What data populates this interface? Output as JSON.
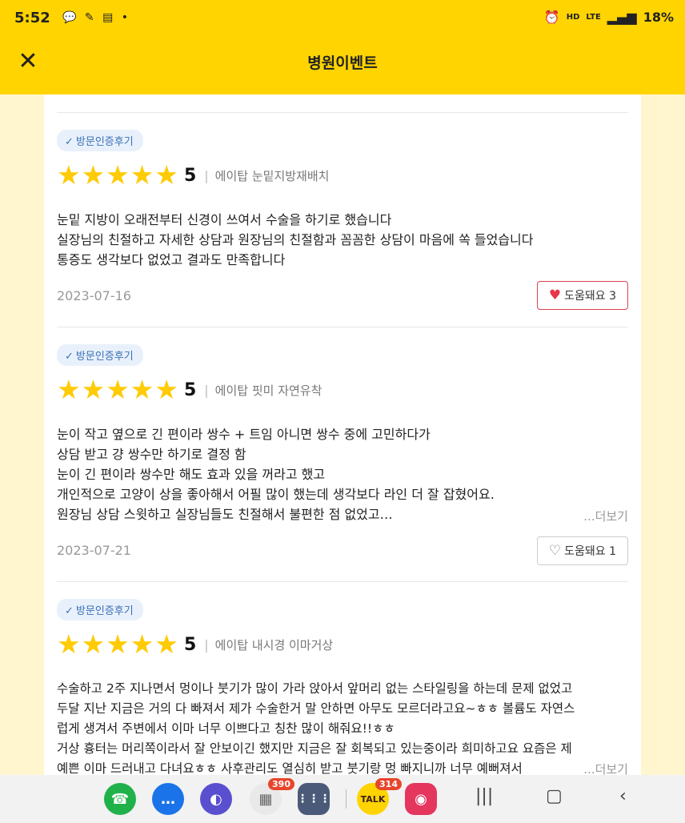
{
  "status_bar": {
    "time": "5:52",
    "left_icons": [
      "talk-icon",
      "pen-icon",
      "grid-icon",
      "dot-icon"
    ],
    "network": "HD",
    "network_sub": "LTE",
    "battery": "18%"
  },
  "header": {
    "title": "병원이벤트"
  },
  "reviews": [
    {
      "badge": "방문인증후기",
      "score": "5",
      "procedure": "에이탑 눈밑지방재배치",
      "lines": [
        "눈밑 지방이 오래전부터 신경이 쓰여서 수술을 하기로 했습니다",
        "실장님의 친절하고 자세한 상담과 원장님의 친절함과 꼼꼼한 상담이 마음에 쏙 들었습니다",
        "통증도 생각보다 없었고 결과도 만족합니다"
      ],
      "date": "2023-07-16",
      "helpful_label": "도움돼요 3",
      "helpful_active": true
    },
    {
      "badge": "방문인증후기",
      "score": "5",
      "procedure": "에이탑 핏미 자연유착",
      "lines": [
        "눈이 작고 옆으로 긴 편이라 쌍수 + 트임 아니면 쌍수 중에 고민하다가",
        "상담 받고 걍 쌍수만 하기로 결정 함",
        "눈이 긴 편이라 쌍수만 해도 효과 있을 꺼라고 했고",
        "개인적으로 고양이 상을 좋아해서 어필 많이 했는데 생각보다 라인 더 잘 잡혔어요.",
        "원장님 상담 스윗하고 실장님들도 친절해서 불편한 점 없었고…"
      ],
      "more": "...더보기",
      "date": "2023-07-21",
      "helpful_label": "도움돼요 1",
      "helpful_active": false
    },
    {
      "badge": "방문인증후기",
      "score": "5",
      "procedure": "에이탑 내시경 이마거상",
      "lines": [
        "수술하고 2주 지나면서 멍이나 붓기가 많이 가라 앉아서 앞머리 없는 스타일링을 하는데 문제 없었고",
        "두달 지난 지금은 거의 다 빠져서 제가 수술한거 말 안하면 아무도 모르더라고요~ㅎㅎ 볼륨도 자연스",
        "럽게 생겨서 주변에서 이마 너무 이쁘다고 칭찬 많이 해줘요!!ㅎㅎ",
        "거상 흉터는 머리쪽이라서 잘 안보이긴 했지만 지금은 잘 회복되고 있는중이라 희미하고요 요즘은 제",
        "예쁜 이마 드러내고 다녀요ㅎㅎ 사후관리도 열심히 받고 붓기랑 멍 빠지니까 너무 예뻐져서"
      ],
      "more": "...더보기"
    }
  ],
  "nav": {
    "apps": [
      {
        "name": "phone-app-icon",
        "color": "#21b14b",
        "glyph": "☎"
      },
      {
        "name": "messages-app-icon",
        "color": "#1a73e8",
        "glyph": "…"
      },
      {
        "name": "internet-app-icon",
        "color": "#5a4fcf",
        "glyph": "◐"
      },
      {
        "name": "apps-folder-icon",
        "color": "#e9e9e9",
        "glyph": "▦",
        "badge": "390"
      },
      {
        "name": "app-drawer-icon",
        "color": "#4a5a78",
        "glyph": "⋮⋮⋮"
      },
      {
        "name": "kakaotalk-app-icon",
        "color": "#ffd400",
        "glyph": "TALK",
        "badge": "314"
      },
      {
        "name": "camera-app-icon",
        "color": "#e5365e",
        "glyph": "◉"
      }
    ]
  }
}
